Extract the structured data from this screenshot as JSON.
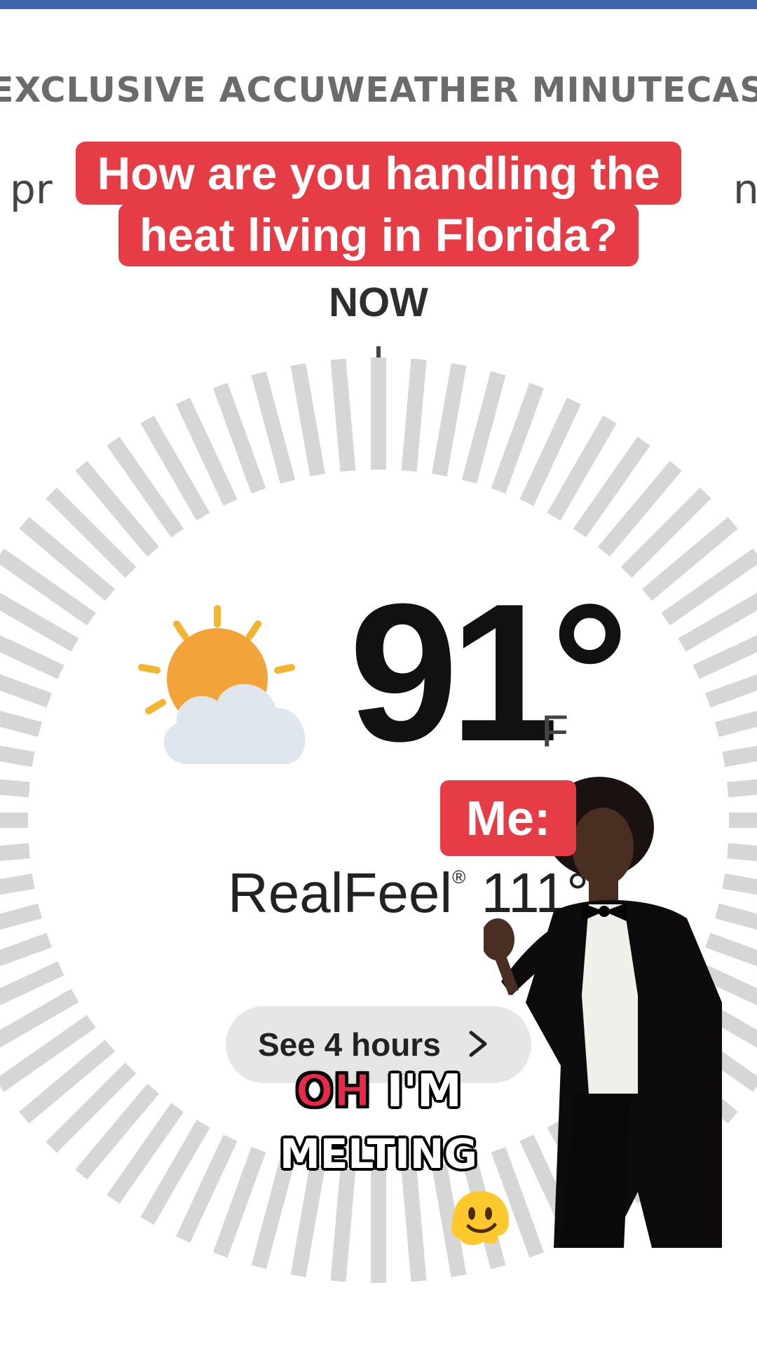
{
  "header": {
    "text": "EXCLUSIVE ACCUWEATHER MINUTECAST"
  },
  "partial_left": "pr",
  "partial_right": "n",
  "caption": {
    "line1": "How are you handling the",
    "line2": "heat living in Florida?"
  },
  "dial": {
    "label": "NOW"
  },
  "current": {
    "temperature": "91°",
    "unit": "F",
    "realfeel_label": "RealFeel",
    "realfeel_mark": "®",
    "realfeel_value": "111°"
  },
  "button": {
    "label": "See 4 hours"
  },
  "meme": {
    "me_label": "Me:",
    "line1_red": "OH",
    "line1_white": "I'M",
    "line2": "MELTING"
  },
  "icons": {
    "weather": "partly-sunny-icon",
    "chevron": "chevron-right-icon",
    "emoji": "melting-face-emoji"
  },
  "colors": {
    "caption_bg": "#e63c46",
    "top_bar": "#3f63ad",
    "dial_tick": "#d6d6d6",
    "sun": "#f2a43a"
  }
}
